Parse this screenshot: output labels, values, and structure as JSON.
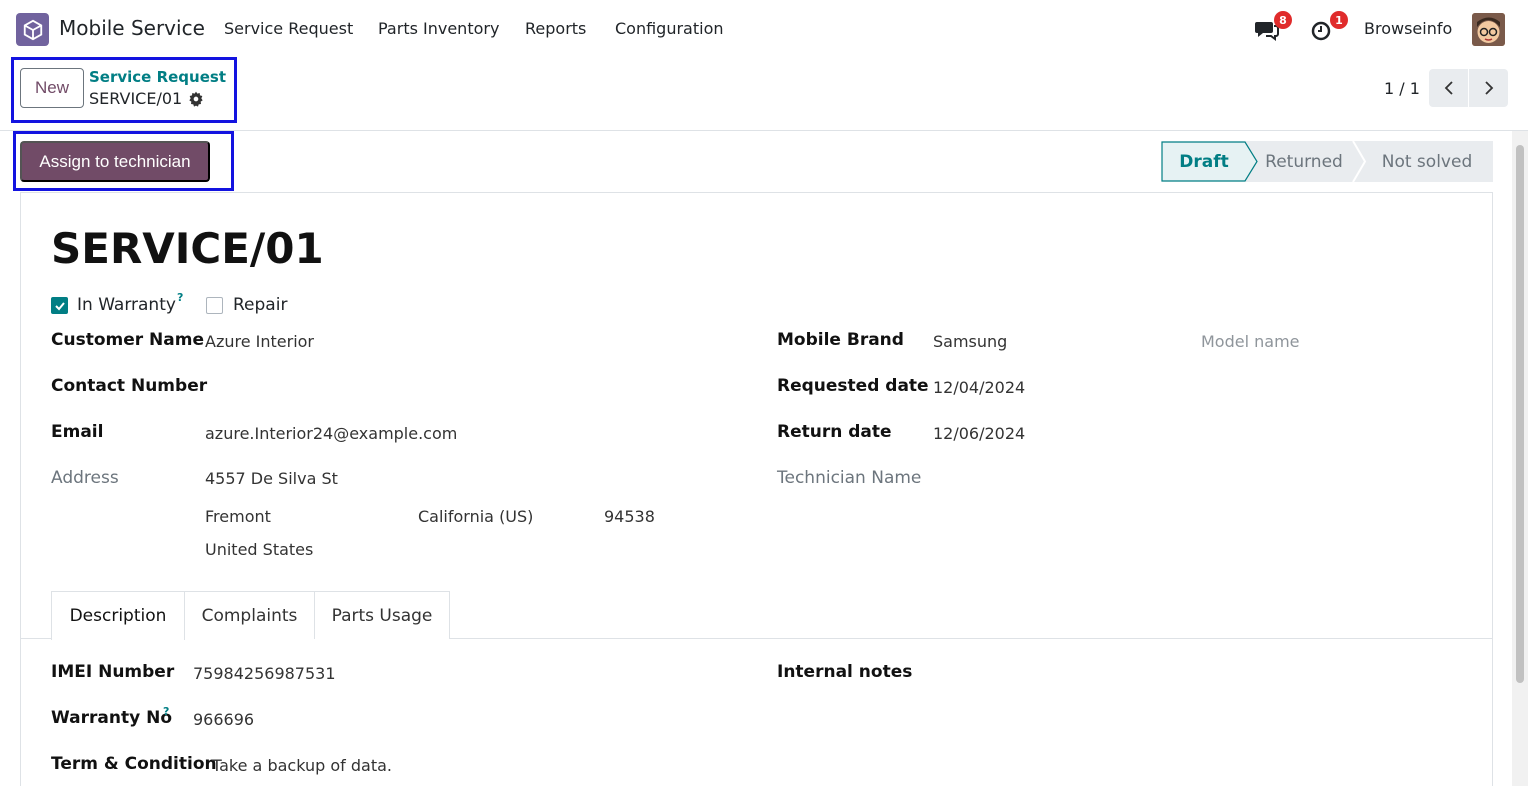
{
  "navbar": {
    "app_name": "Mobile Service",
    "menus": [
      "Service Request",
      "Parts Inventory",
      "Reports",
      "Configuration"
    ],
    "messages_badge": "8",
    "activities_badge": "1",
    "user_name": "Browseinfo"
  },
  "control_panel": {
    "new_label": "New",
    "breadcrumb_parent": "Service Request",
    "breadcrumb_current": "SERVICE/01",
    "pager": "1 / 1"
  },
  "statusbar": {
    "action_label": "Assign to technician",
    "stages": [
      "Draft",
      "Returned",
      "Not solved"
    ],
    "active_stage": "Draft"
  },
  "form": {
    "title": "SERVICE/01",
    "in_warranty_label": "In Warranty",
    "in_warranty_checked": true,
    "repair_label": "Repair",
    "repair_checked": false,
    "help_mark": "?",
    "customer_name_label": "Customer Name",
    "customer_name": "Azure Interior",
    "contact_number_label": "Contact Number",
    "email_label": "Email",
    "email": "azure.Interior24@example.com",
    "address_label": "Address",
    "street": "4557 De Silva St",
    "city": "Fremont",
    "state": "California (US)",
    "zip": "94538",
    "country": "United States",
    "mobile_brand_label": "Mobile Brand",
    "mobile_brand": "Samsung",
    "model_placeholder": "Model name",
    "requested_date_label": "Requested date",
    "requested_date": "12/04/2024",
    "return_date_label": "Return date",
    "return_date": "12/06/2024",
    "technician_label": "Technician Name"
  },
  "tabs": [
    "Description",
    "Complaints",
    "Parts Usage"
  ],
  "description": {
    "imei_label": "IMEI Number",
    "imei": "75984256987531",
    "warranty_no_label": "Warranty No",
    "warranty_no": "966696",
    "terms_label": "Term & Condition",
    "terms": "Take a backup of data.",
    "internal_notes_label": "Internal notes"
  },
  "colors": {
    "brand": "#714b67",
    "accent": "#017e84",
    "highlight": "#1313e0",
    "badge": "#e02b2b"
  }
}
